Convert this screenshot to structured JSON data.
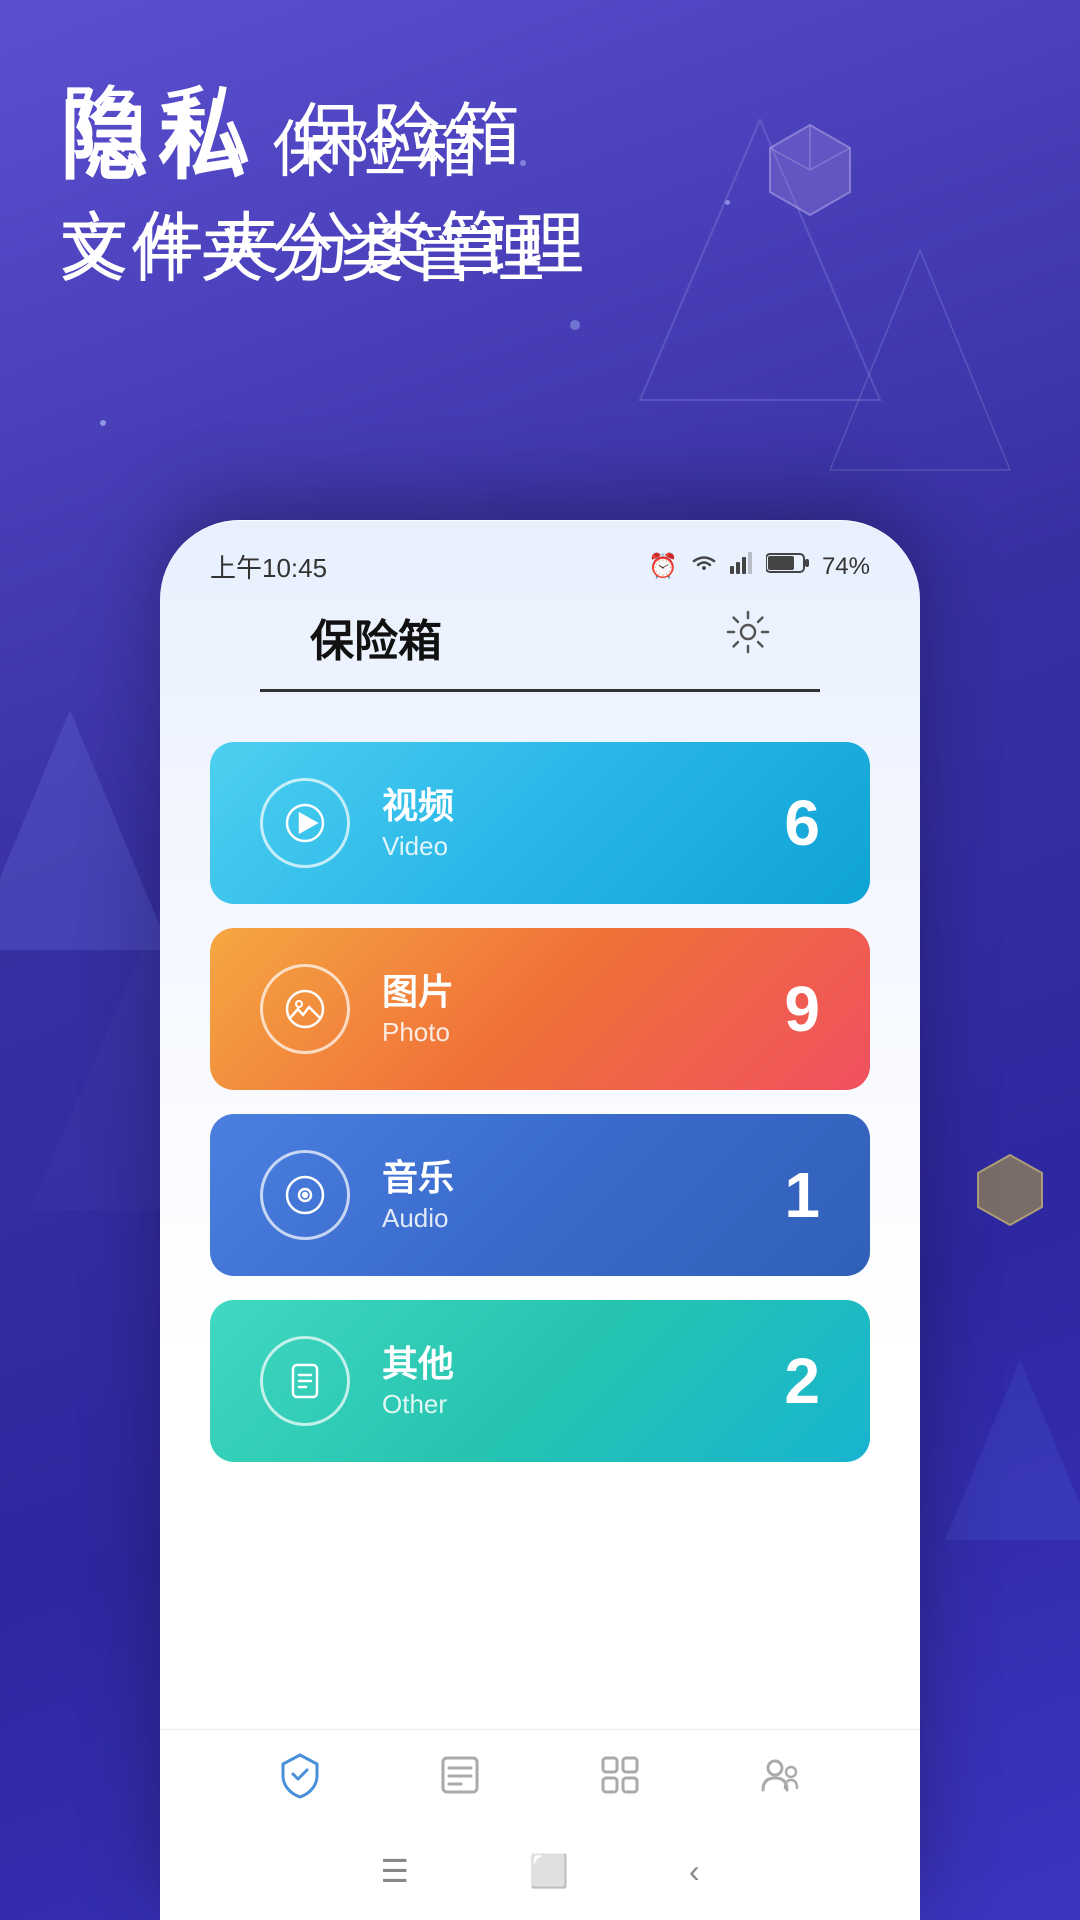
{
  "background": {
    "gradient_start": "#5b4fcf",
    "gradient_end": "#2d27a0"
  },
  "header": {
    "title_part1": "隐私",
    "title_part2": "保险箱",
    "subtitle": "文件夹分类管理"
  },
  "status_bar": {
    "time": "上午10:45",
    "battery_percent": "74%"
  },
  "app_bar": {
    "title": "保险箱",
    "settings_label": "设置"
  },
  "categories": [
    {
      "id": "video",
      "name_zh": "视频",
      "name_en": "Video",
      "count": "6",
      "icon": "play"
    },
    {
      "id": "photo",
      "name_zh": "图片",
      "name_en": "Photo",
      "count": "9",
      "icon": "image"
    },
    {
      "id": "audio",
      "name_zh": "音乐",
      "name_en": "Audio",
      "count": "1",
      "icon": "music"
    },
    {
      "id": "other",
      "name_zh": "其他",
      "name_en": "Other",
      "count": "2",
      "icon": "file"
    }
  ],
  "bottom_nav": {
    "items": [
      {
        "id": "safe",
        "label": "保险箱",
        "active": true
      },
      {
        "id": "files",
        "label": "文件",
        "active": false
      },
      {
        "id": "apps",
        "label": "应用",
        "active": false
      },
      {
        "id": "contacts",
        "label": "联系人",
        "active": false
      }
    ]
  }
}
